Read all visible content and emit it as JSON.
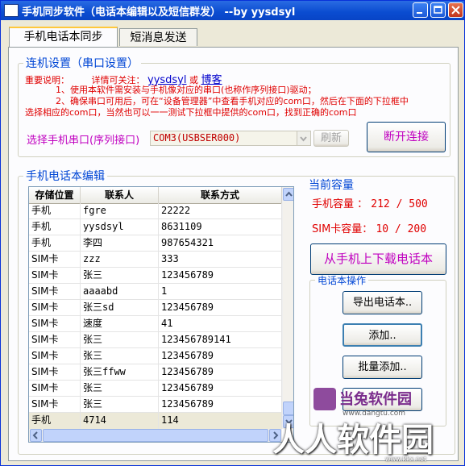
{
  "window": {
    "title": "手机同步软件（电话本编辑以及短信群发） --by yysdsyl",
    "icon": "app-window-icon"
  },
  "tabs": [
    {
      "label": "手机电话本同步",
      "active": true
    },
    {
      "label": "短消息发送",
      "active": false
    }
  ],
  "connection": {
    "legend": "连机设置（串口设置）",
    "note_prefix": "重要说明：",
    "note_follow": "详情可关注：",
    "link_author": "yysdsyl",
    "or_text": "或",
    "link_blog": "博客",
    "note_line1": "1、使用本软件需安装与手机像对应的串口(也称作序列接口)驱动；",
    "note_line2": "2、确保串口可用后，可在“设备管理器”中查看手机对应的com口，然后在下面的下拉框中",
    "note_line3": "选择相应的com口，当然也可以一一测试下拉框中提供的com口，找到正确的com口",
    "port_label": "选择手机串口(序列接口)",
    "port_value": "COM3(USBSER000)",
    "refresh_label": "刷新",
    "disconnect_label": "断开连接"
  },
  "phonebook": {
    "legend": "手机电话本编辑",
    "columns": [
      "存储位置",
      "联系人",
      "联系方式"
    ],
    "rows": [
      {
        "loc": "手机",
        "name": "fgre",
        "phone": "22222"
      },
      {
        "loc": "手机",
        "name": "yysdsyl",
        "phone": "8631109"
      },
      {
        "loc": "手机",
        "name": "李四",
        "phone": "987654321"
      },
      {
        "loc": "SIM卡",
        "name": "zzz",
        "phone": "333"
      },
      {
        "loc": "SIM卡",
        "name": "张三",
        "phone": "123456789"
      },
      {
        "loc": "SIM卡",
        "name": "aaaabd",
        "phone": "1"
      },
      {
        "loc": "SIM卡",
        "name": "张三sd",
        "phone": "123456789"
      },
      {
        "loc": "SIM卡",
        "name": "速度",
        "phone": "41"
      },
      {
        "loc": "SIM卡",
        "name": "张三",
        "phone": "123456789141"
      },
      {
        "loc": "SIM卡",
        "name": "张三",
        "phone": "123456789"
      },
      {
        "loc": "SIM卡",
        "name": "张三ffww",
        "phone": "123456789"
      },
      {
        "loc": "SIM卡",
        "name": "张三",
        "phone": "123456789"
      },
      {
        "loc": "SIM卡",
        "name": "张三",
        "phone": "123456789"
      },
      {
        "loc": "手机",
        "name": "4714",
        "phone": "114"
      }
    ]
  },
  "capacity": {
    "legend": "当前容量",
    "phone_label": "手机容量 ：",
    "phone_value": "212 / 500",
    "sim_label": "SIM卡容量：",
    "sim_value": "10 / 200"
  },
  "download_label": "从手机上下载电话本",
  "ops": {
    "legend": "电话本操作",
    "export_label": "导出电话本..",
    "add_label": "添加..",
    "batch_add_label": "批量添加.."
  },
  "watermark": {
    "logo_text": "当兔软件园",
    "logo_url": "www.dangtu.com",
    "big_text": "人人软件园",
    "small_text": "www.kkx.net"
  }
}
